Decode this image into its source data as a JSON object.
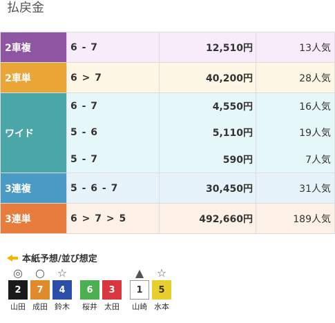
{
  "title": "払戻金",
  "payouts": [
    {
      "type": "2車複",
      "rows": [
        {
          "combo": "6 - 7",
          "amount": "12,510円",
          "pop": "13人気"
        }
      ]
    },
    {
      "type": "2車単",
      "rows": [
        {
          "combo": "6 > 7",
          "amount": "40,200円",
          "pop": "28人気"
        }
      ]
    },
    {
      "type": "ワイド",
      "rows": [
        {
          "combo": "6 - 7",
          "amount": "4,550円",
          "pop": "16人気"
        },
        {
          "combo": "5 - 6",
          "amount": "5,110円",
          "pop": "19人気"
        },
        {
          "combo": "5 - 7",
          "amount": "590円",
          "pop": "7人気"
        }
      ]
    },
    {
      "type": "3連複",
      "rows": [
        {
          "combo": "5 - 6 - 7",
          "amount": "30,450円",
          "pop": "31人気"
        }
      ]
    },
    {
      "type": "3連単",
      "rows": [
        {
          "combo": "6 > 7 > 5",
          "amount": "492,660円",
          "pop": "189人気"
        }
      ]
    }
  ],
  "forecast": {
    "heading": "本紙予想/並び想定",
    "groups": [
      {
        "picks": [
          {
            "mark": "◎",
            "num": "2",
            "name": "山田",
            "bg": "#1a1a1a",
            "fg": "#ffffff"
          },
          {
            "mark": "○",
            "num": "7",
            "name": "成田",
            "bg": "#e08a2c",
            "fg": "#ffffff"
          },
          {
            "mark": "☆",
            "num": "4",
            "name": "鈴木",
            "bg": "#2b4fa8",
            "fg": "#ffffff"
          }
        ]
      },
      {
        "picks": [
          {
            "mark": "",
            "num": "6",
            "name": "桜井",
            "bg": "#4caf50",
            "fg": "#ffffff"
          },
          {
            "mark": "",
            "num": "3",
            "name": "太田",
            "bg": "#d9363e",
            "fg": "#ffffff"
          }
        ]
      },
      {
        "picks": [
          {
            "mark": "▲",
            "num": "1",
            "name": "山崎",
            "bg": "#ffffff",
            "fg": "#333333"
          },
          {
            "mark": "☆",
            "num": "5",
            "name": "水本",
            "bg": "#e8cf2e",
            "fg": "#333333"
          }
        ]
      }
    ]
  }
}
